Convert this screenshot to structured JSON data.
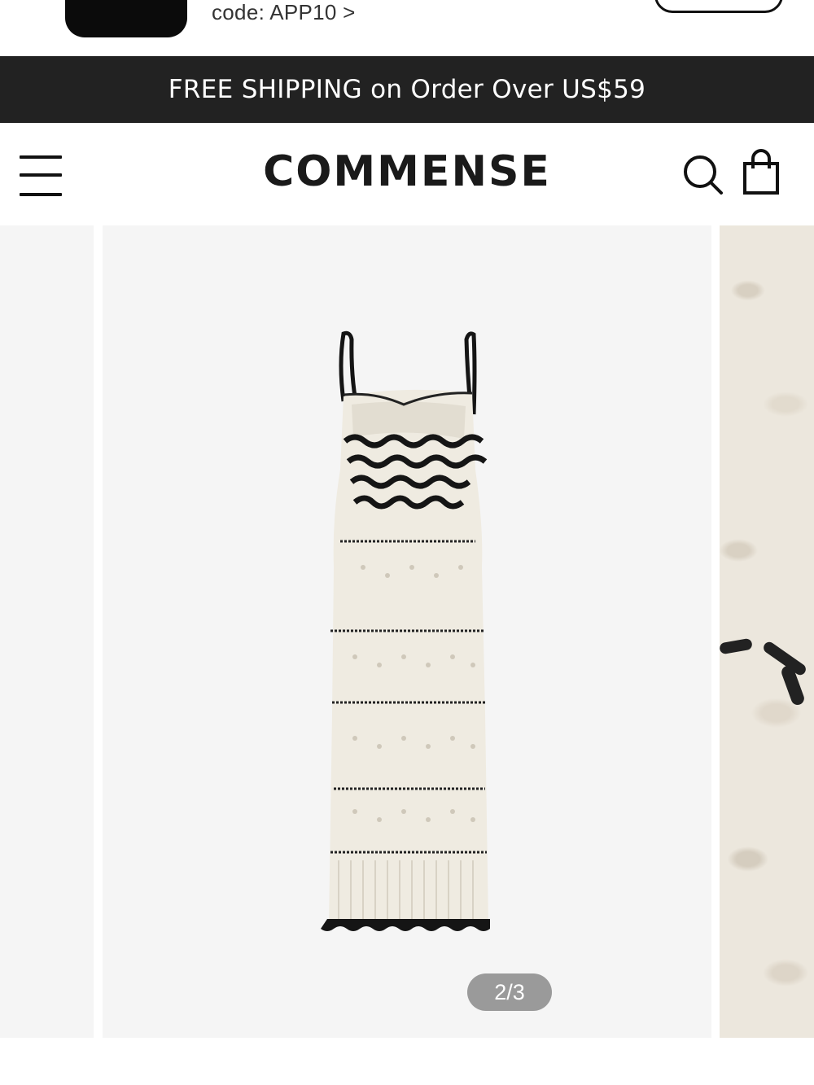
{
  "app_banner": {
    "promo_text": "code: APP10 >"
  },
  "shipping_bar": {
    "text": "FREE SHIPPING on Order Over US$59"
  },
  "header": {
    "logo_text": "COMMENSE",
    "icons": [
      "menu-icon",
      "search-icon",
      "shopping-bag-icon"
    ]
  },
  "gallery": {
    "counter": "2/3",
    "current_slide": 2,
    "total_slides": 3
  },
  "colors": {
    "shipping_bar_bg": "#222222",
    "slide_bg": "#f5f5f5",
    "counter_bg": "#9a9a9a",
    "dress_cream": "#efebe1",
    "dress_stripe": "#151515"
  }
}
